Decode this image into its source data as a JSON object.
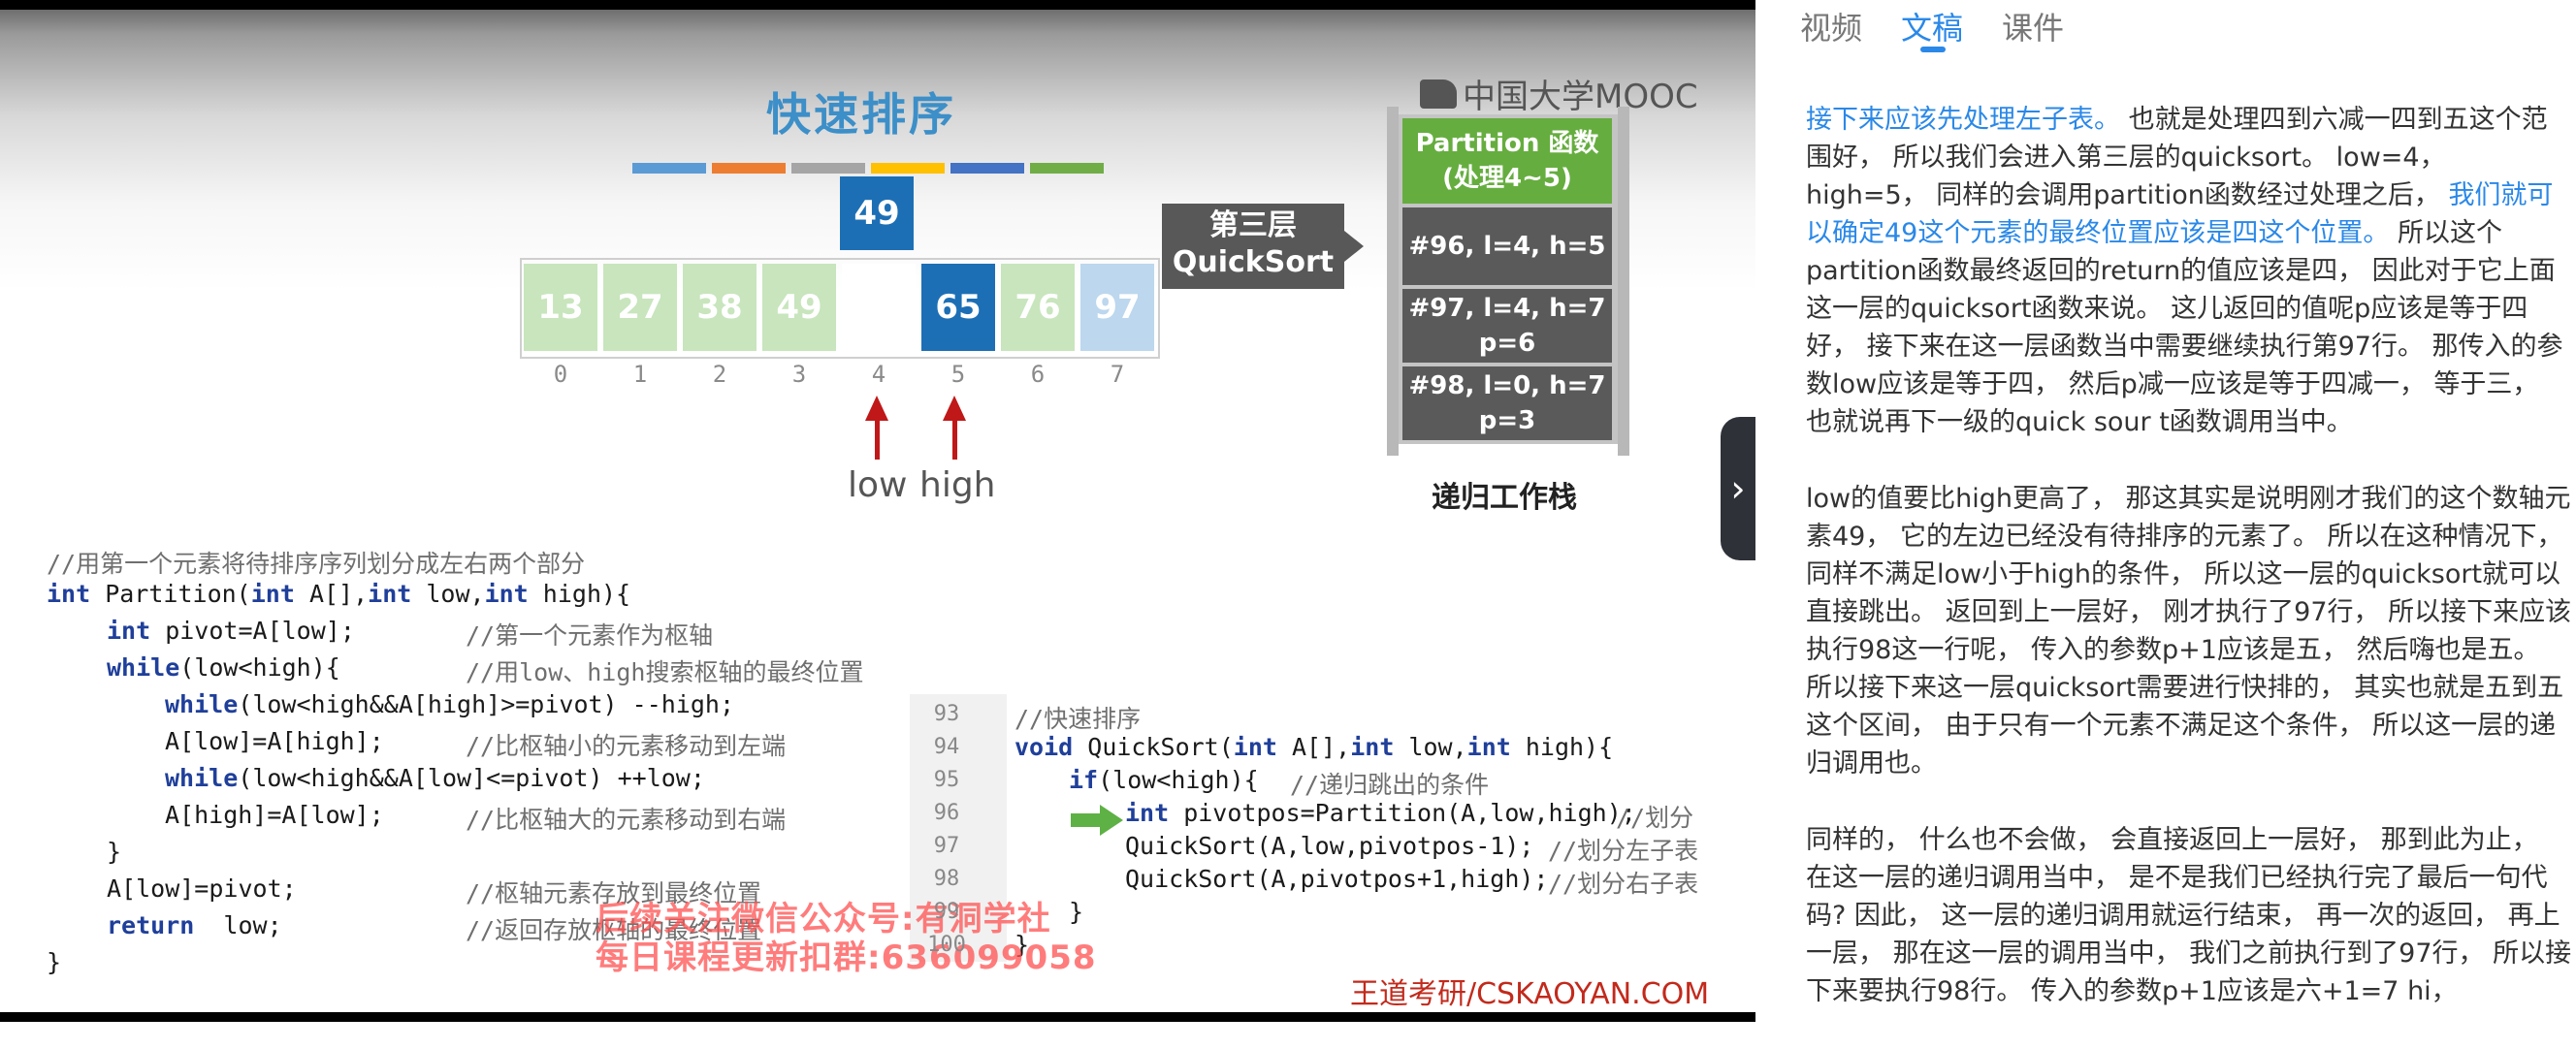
{
  "video": {
    "slide_title": "快速排序",
    "brand_logo": "中国大学MOOC",
    "color_bars": [
      "#5b9bd5",
      "#ed7d31",
      "#a5a5a5",
      "#ffc000",
      "#4472c4",
      "#70ad47"
    ],
    "pivot_value": "49",
    "array_cells": [
      {
        "value": "13",
        "color": "#c8e5bd"
      },
      {
        "value": "27",
        "color": "#c8e5bd"
      },
      {
        "value": "38",
        "color": "#c8e5bd"
      },
      {
        "value": "49",
        "color": "#c8e5bd"
      },
      {
        "value": "",
        "color": "#ffffff"
      },
      {
        "value": "65",
        "color": "#1d6fb5"
      },
      {
        "value": "76",
        "color": "#c8e5bd"
      },
      {
        "value": "97",
        "color": "#bcd7ee"
      }
    ],
    "indices": [
      "0",
      "1",
      "2",
      "3",
      "4",
      "5",
      "6",
      "7"
    ],
    "pointer_low": "low",
    "pointer_high": "high",
    "callout_line1": "第三层",
    "callout_line2": "QuickSort",
    "stack_frames": [
      {
        "line1": "Partition 函数",
        "line2": "(处理4~5)"
      },
      {
        "line1": "#96, l=4, h=5",
        "line2": ""
      },
      {
        "line1": "#97, l=4, h=7",
        "line2": "p=6"
      },
      {
        "line1": "#98, l=0, h=7",
        "line2": "p=3"
      }
    ],
    "stack_caption": "递归工作栈",
    "partition_code": {
      "comment_header": "//用第一个元素将待排序序列划分成左右两个部分",
      "l1_kw1": "int",
      "l1_a": " Partition(",
      "l1_kw2": "int",
      "l1_b": " A[],",
      "l1_kw3": "int",
      "l1_c": " low,",
      "l1_kw4": "int",
      "l1_d": " high){",
      "l2_kw": "int",
      "l2_code": " pivot=A[low];",
      "l2_cm": "//第一个元素作为枢轴",
      "l3_kw": "while",
      "l3_code": "(low<high){",
      "l3_cm": "//用low、high搜索枢轴的最终位置",
      "l4_kw": "while",
      "l4_code": "(low<high&&A[high]>=pivot) --high;",
      "l5_code": "A[low]=A[high];",
      "l5_cm": "//比枢轴小的元素移动到左端",
      "l6_kw": "while",
      "l6_code": "(low<high&&A[low]<=pivot) ++low;",
      "l7_code": "A[high]=A[low];",
      "l7_cm": "//比枢轴大的元素移动到右端",
      "l8_code": "}",
      "l9_code": "A[low]=pivot;",
      "l9_cm": "//枢轴元素存放到最终位置",
      "l10_kw": "return",
      "l10_code": "  low;",
      "l10_cm": "//返回存放枢轴的最终位置",
      "l11_code": "}"
    },
    "quicksort_code": {
      "line_numbers": [
        "93",
        "94",
        "95",
        "96",
        "97",
        "98",
        "99",
        "100"
      ],
      "l93_cm": "//快速排序",
      "l94_kw1": "void",
      "l94_a": " QuickSort(",
      "l94_kw2": "int",
      "l94_b": " A[],",
      "l94_kw3": "int",
      "l94_c": " low,",
      "l94_kw4": "int",
      "l94_d": " high){",
      "l95_kw": "if",
      "l95_code": "(low<high){",
      "l95_cm": "//递归跳出的条件",
      "l96_kw": "int",
      "l96_code": " pivotpos=Partition(A,low,high);",
      "l96_cm": "//划分",
      "l97_code": "QuickSort(A,low,pivotpos-1);",
      "l97_cm": "//划分左子表",
      "l98_code": "QuickSort(A,pivotpos+1,high);",
      "l98_cm": "//划分右子表",
      "l99_code": "}",
      "l100_code": "}"
    },
    "watermark_line1": "后续关注微信公众号:有洞学社",
    "watermark_line2": "每日课程更新扣群:636099058",
    "credit": "王道考研/CSKAOYAN.COM"
  },
  "tabs": [
    {
      "label": "视频"
    },
    {
      "label": "文稿"
    },
    {
      "label": "课件"
    }
  ],
  "transcript": {
    "p1_hl1": "接下来应该先处理左子表。",
    "p1_t1": " 也就是处理四到六减一四到五这个范围好， 所以我们会进入第三层的quicksort。 low=4， high=5， 同样的会调用partition函数经过处理之后， ",
    "p1_hl2": "我们就可以确定49这个元素的最终位置应该是四这个位置。",
    "p1_t2": " 所以这个partition函数最终返回的return的值应该是四， 因此对于它上面这一层的quicksort函数来说。 这儿返回的值呢p应该是等于四好， 接下来在这一层函数当中需要继续执行第97行。 那传入的参数low应该是等于四， 然后p减一应该是等于四减一， 等于三， 也就说再下一级的quick sour t函数调用当中。",
    "p2": "low的值要比high更高了， 那这其实是说明刚才我们的这个数轴元素49， 它的左边已经没有待排序的元素了。 所以在这种情况下， 同样不满足low小于high的条件， 所以这一层的quicksort就可以直接跳出。 返回到上一层好， 刚才执行了97行， 所以接下来应该执行98这一行呢， 传入的参数p+1应该是五， 然后嗨也是五。 所以接下来这一层quicksort需要进行快排的， 其实也就是五到五这个区间， 由于只有一个元素不满足这个条件， 所以这一层的递归调用也。",
    "p3": "同样的， 什么也不会做， 会直接返回上一层好， 那到此为止， 在这一层的递归调用当中， 是不是我们已经执行完了最后一句代码? 因此， 这一层的递归调用就运行结束， 再一次的返回， 再上一层， 那在这一层的调用当中， 我们之前执行到了97行， 所以接下来要执行98行。 传入的参数p+1应该是六+1=7 hi，"
  }
}
